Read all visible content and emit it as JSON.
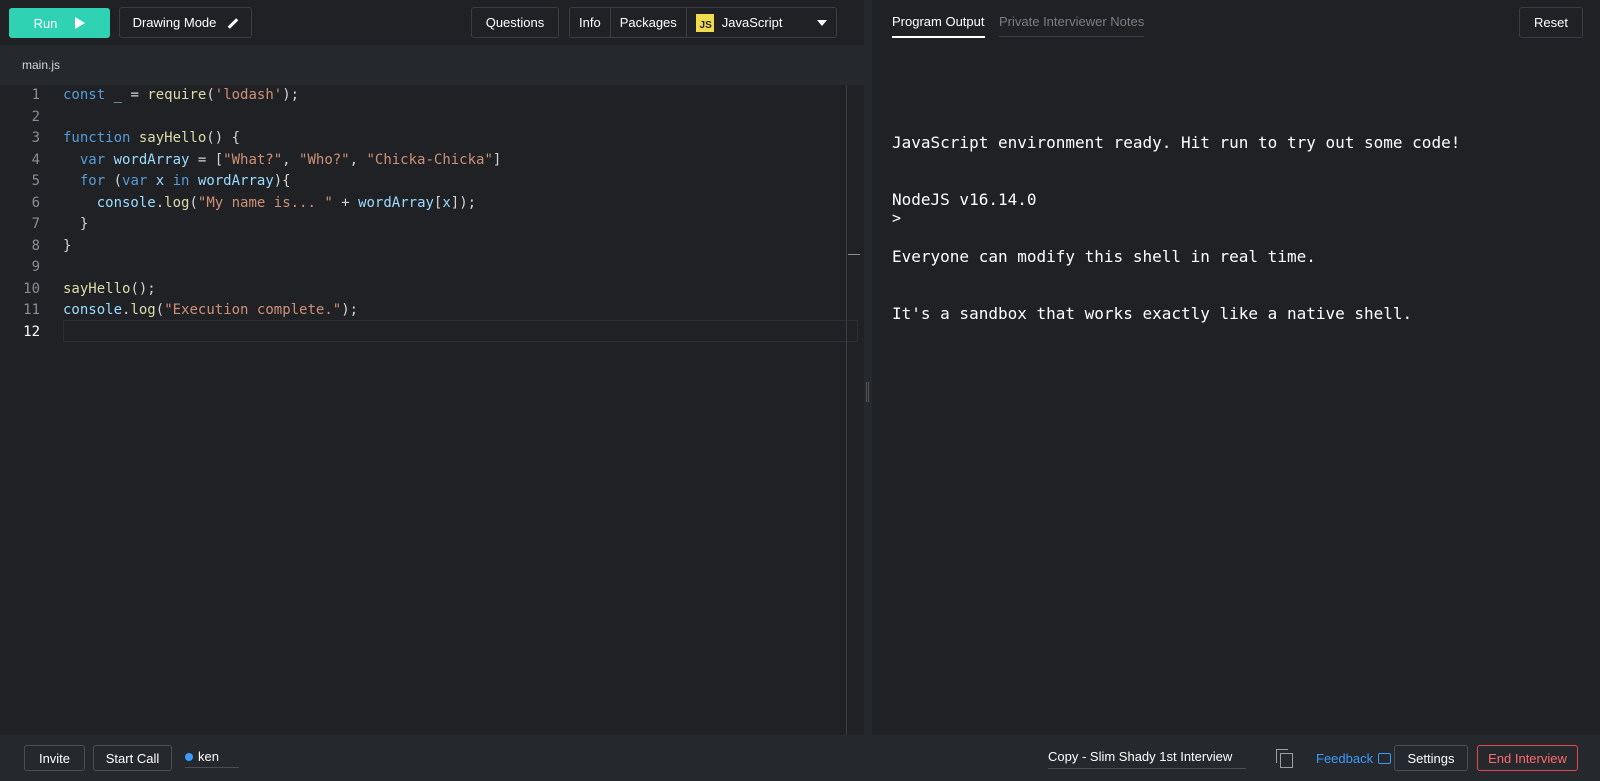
{
  "toolbar": {
    "run_label": "Run",
    "drawing_mode_label": "Drawing Mode",
    "questions_label": "Questions",
    "info_label": "Info",
    "packages_label": "Packages",
    "language_badge": "JS",
    "language_label": "JavaScript"
  },
  "file_tab": "main.js",
  "editor": {
    "line_numbers": [
      "1",
      "2",
      "3",
      "4",
      "5",
      "6",
      "7",
      "8",
      "9",
      "10",
      "11",
      "12"
    ],
    "active_line": "12"
  },
  "output_tabs": {
    "program_output": "Program Output",
    "private_notes": "Private Interviewer Notes"
  },
  "reset_label": "Reset",
  "console": {
    "lines": [
      "JavaScript environment ready. Hit run to try out some code!",
      "NodeJS v16.14.0",
      "Everyone can modify this shell in real time.",
      "It's a sandbox that works exactly like a native shell."
    ],
    "prompt": ">"
  },
  "footer": {
    "invite_label": "Invite",
    "start_call_label": "Start Call",
    "user_name": "ken",
    "pad_title": "Copy - Slim Shady 1st Interview",
    "feedback_label": "Feedback",
    "settings_label": "Settings",
    "end_interview_label": "End Interview"
  },
  "colors": {
    "accent_run": "#2fd3b4",
    "link_blue": "#3b9cff",
    "danger": "#e04a4a",
    "js_yellow": "#f0db4f"
  }
}
